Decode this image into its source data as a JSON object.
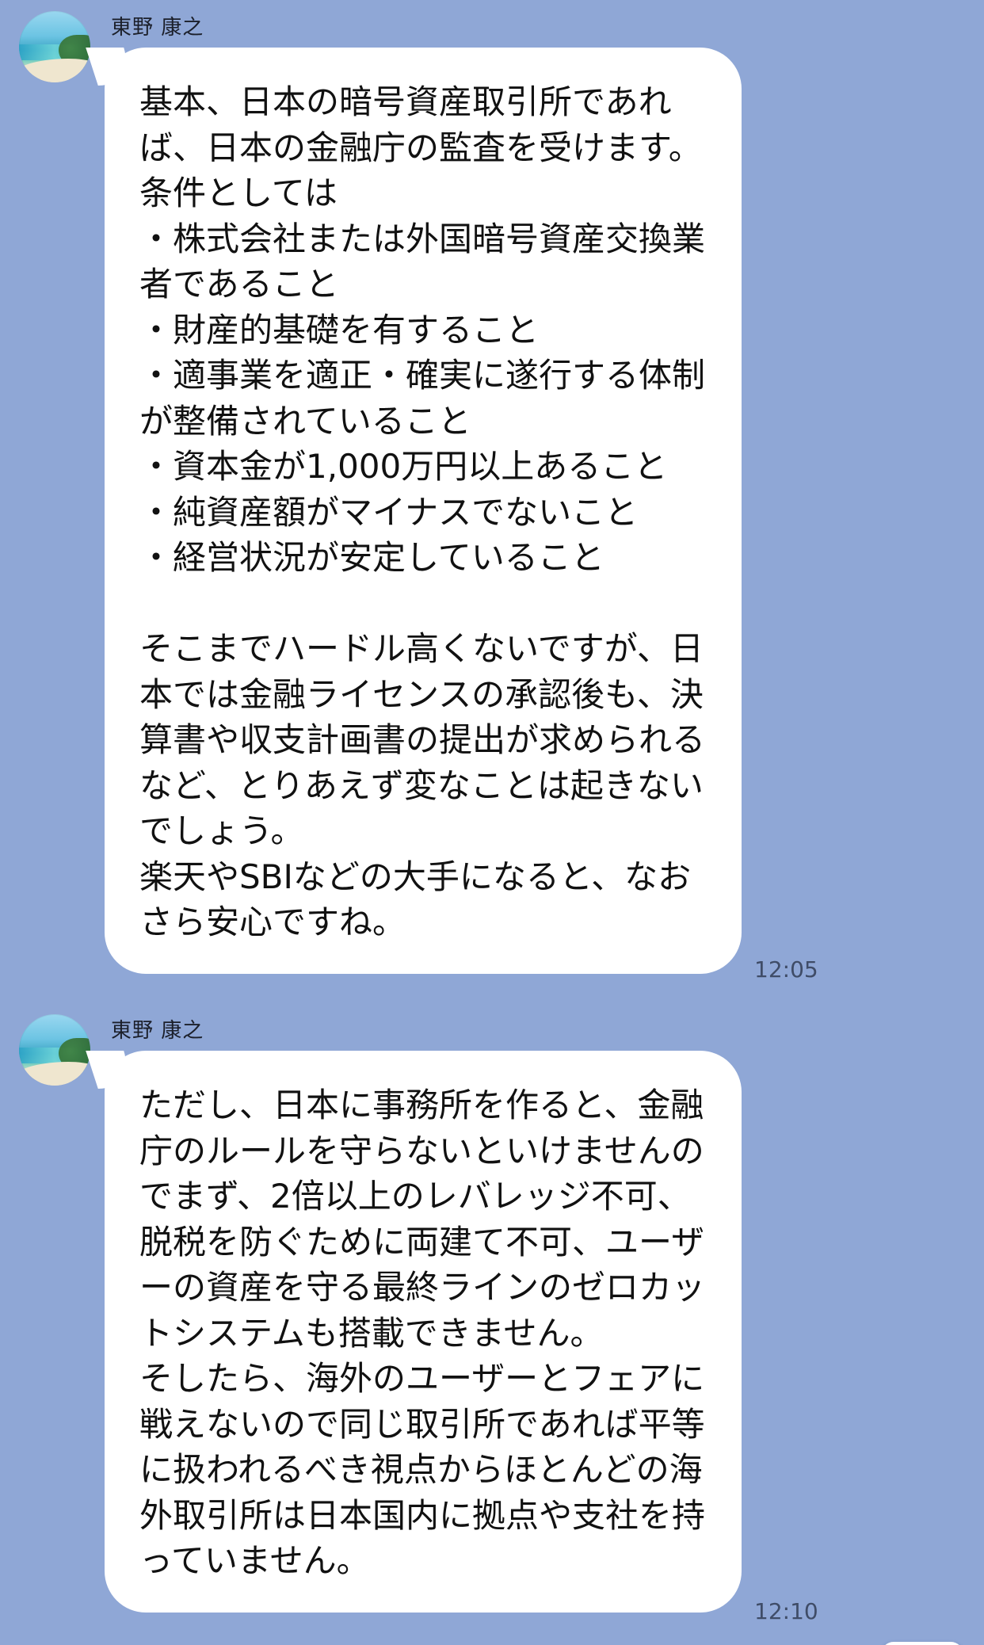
{
  "messages": [
    {
      "sender": "東野 康之",
      "text": "基本、日本の暗号資産取引所であれば、日本の金融庁の監査を受けます。\n条件としては\n・株式会社または外国暗号資産交換業者であること\n・財産的基礎を有すること\n・適事業を適正・確実に遂行する体制が整備されていること\n・資本金が1,000万円以上あること\n・純資産額がマイナスでないこと\n・経営状況が安定していること\n\nそこまでハードル高くないですが、日本では金融ライセンスの承認後も、決算書や収支計画書の提出が求められるなど、とりあえず変なことは起きないでしょう。\n楽天やSBIなどの大手になると、なおさら安心ですね。",
      "time": "12:05",
      "avatar_icon": "beach-photo-avatar"
    },
    {
      "sender": "東野 康之",
      "text": "ただし、日本に事務所を作ると、金融庁のルールを守らないといけませんのでまず、2倍以上のレバレッジ不可、脱税を防ぐために両建て不可、ユーザーの資産を守る最終ラインのゼロカットシステムも搭載できません。\nそしたら、海外のユーザーとフェアに戦えないので同じ取引所であれば平等に扱われるべき視点からほとんどの海外取引所は日本国内に拠点や支社を持っていません。",
      "time": "12:10",
      "avatar_icon": "beach-photo-avatar"
    }
  ],
  "scroll_button": {
    "icon": "scroll-down-icon"
  },
  "colors": {
    "background": "#8fa7d6",
    "bubble": "#ffffff",
    "time": "#3f4c67"
  }
}
